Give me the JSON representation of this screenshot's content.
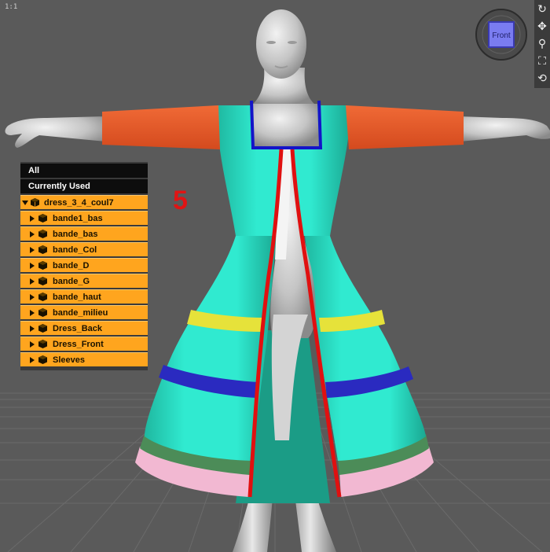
{
  "viewport": {
    "zoom_label": "1:1",
    "camera_cube_label": "Front",
    "annotation_number": "5",
    "colors": {
      "background": "#5a5a5a",
      "grid": "#6e6e6e",
      "dress_body": "#2ee6c8",
      "sleeves": "#ee5a2a",
      "collar_trim": "#1414c8",
      "front_trim": "#e01010",
      "band_yellow": "#e6e23a",
      "band_blue": "#2a2ac0",
      "band_green": "#4c8c58",
      "band_pink": "#f2b8d2",
      "skin": "#cfcfcf"
    }
  },
  "toolbar": {
    "tools": [
      {
        "name": "rotate-tool",
        "glyph": "↻"
      },
      {
        "name": "pan-tool",
        "glyph": "✥"
      },
      {
        "name": "zoom-tool",
        "glyph": "⚲"
      },
      {
        "name": "frame-tool",
        "glyph": "⛶"
      },
      {
        "name": "reset-tool",
        "glyph": "⟲"
      }
    ]
  },
  "scene_tree": {
    "all_label": "All",
    "currently_used_label": "Currently Used",
    "root": {
      "label": "dress_3_4_coul7",
      "expanded": true
    },
    "items": [
      {
        "label": "bande1_bas"
      },
      {
        "label": "bande_bas"
      },
      {
        "label": "bande_Col"
      },
      {
        "label": "bande_D"
      },
      {
        "label": "bande_G"
      },
      {
        "label": "bande_haut"
      },
      {
        "label": "bande_milieu"
      },
      {
        "label": "Dress_Back"
      },
      {
        "label": "Dress_Front"
      },
      {
        "label": "Sleeves"
      }
    ]
  }
}
